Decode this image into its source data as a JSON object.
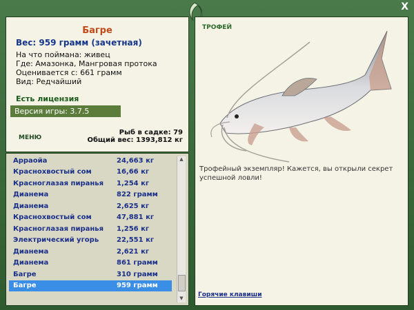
{
  "window": {
    "close_label": "X",
    "logo_icon": "fish-logo-icon"
  },
  "catch": {
    "fish_name": "Багре",
    "weight_label": "Вес: 959 грамм (зачетная)",
    "bait": "На что поймана: живец",
    "location": "Где: Амазонка, Мангровая протока",
    "value": "Оценивается с: 661 грамм",
    "kind": "Вид: Редчайший"
  },
  "license_label": "Есть лицензия",
  "version_label": "Версия игры: 3.7.5",
  "menu_label": "МЕНЮ",
  "stats": {
    "fish_count": "Рыб в садке: 79",
    "total_weight": "Общий вес: 1393,812 кг"
  },
  "catch_list": [
    {
      "name": "Арраойа",
      "weight": "24,663 кг"
    },
    {
      "name": "Краснохвостый сом",
      "weight": "16,66 кг"
    },
    {
      "name": "Красноглазая пиранья",
      "weight": "1,254 кг"
    },
    {
      "name": "Дианема",
      "weight": "822 грамм"
    },
    {
      "name": "Дианема",
      "weight": "2,625 кг"
    },
    {
      "name": "Краснохвостый сом",
      "weight": "47,881 кг"
    },
    {
      "name": "Красноглазая пиранья",
      "weight": "1,256 кг"
    },
    {
      "name": "Электрический угорь",
      "weight": "22,551 кг"
    },
    {
      "name": "Дианема",
      "weight": "2,621 кг"
    },
    {
      "name": "Дианема",
      "weight": "861 грамм"
    },
    {
      "name": "Багре",
      "weight": "310 грамм"
    },
    {
      "name": "Багре",
      "weight": "959 грамм"
    }
  ],
  "selected_index": 11,
  "trophy_label": "ТРОФЕЙ",
  "description": "Трофейный экземпляр! Кажется, вы открыли секрет успешной ловли!",
  "hotkeys_label": "Горячие клавиши",
  "colors": {
    "frame": "#3d6b3d",
    "panel": "#f4f3e6",
    "selection": "#3a8ee6",
    "fish_title": "#c24a18"
  }
}
